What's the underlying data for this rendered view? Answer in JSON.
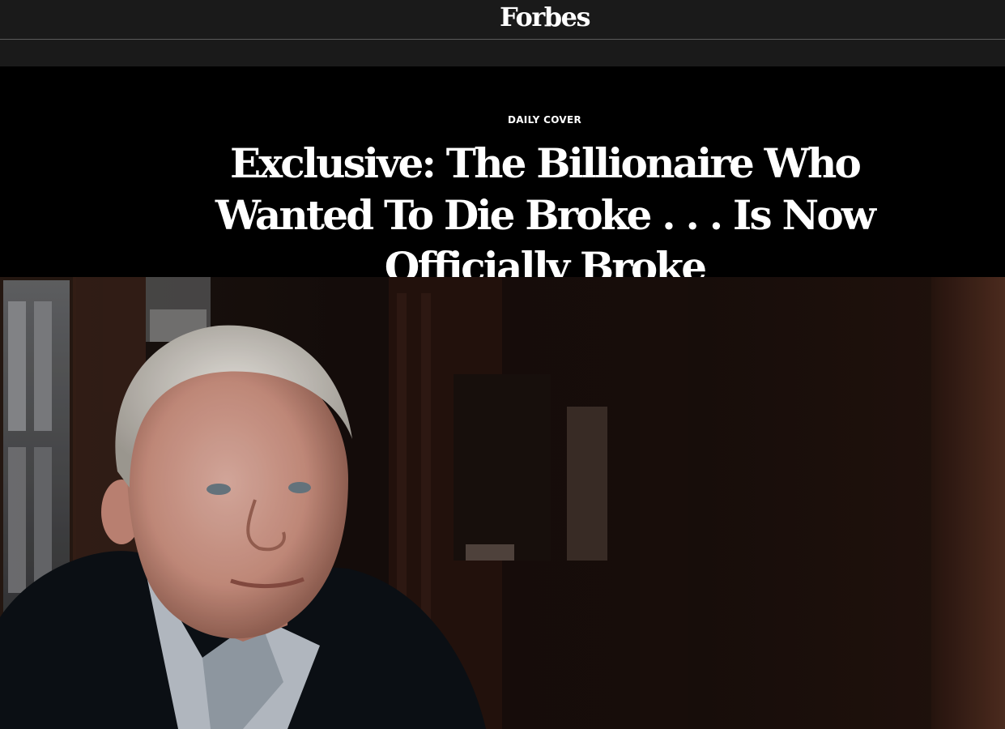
{
  "header": {
    "logo_text": "Forbes"
  },
  "article": {
    "kicker": "DAILY COVER",
    "headline": "Exclusive: The Billionaire Who Wanted To Die Broke . . . Is Now Officially Broke"
  },
  "colors": {
    "topbar_background": "#1a1a1a",
    "hero_background": "#000000",
    "text": "#ffffff"
  }
}
